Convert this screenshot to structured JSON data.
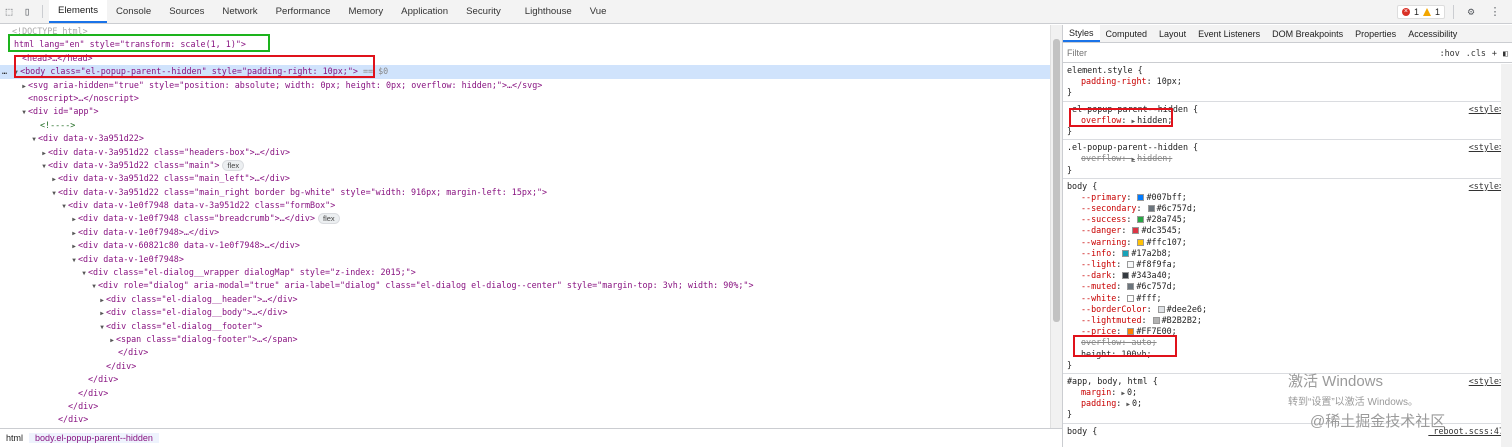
{
  "toolbar": {
    "tabs": [
      "Elements",
      "Console",
      "Sources",
      "Network",
      "Performance",
      "Memory",
      "Application",
      "Security",
      "Lighthouse",
      "Vue"
    ],
    "errors": "1",
    "warnings": "1"
  },
  "dom": {
    "lines": [
      "<!DOCTYPE html>",
      "html lang=\"en\" style=\"transform: scale(1, 1)\">",
      "<head>…</head>",
      "<body class=\"el-popup-parent--hidden\" style=\"padding-right: 10px;\">",
      "== $0",
      "<svg aria-hidden=\"true\" style=\"position: absolute; width: 0px; height: 0px; overflow: hidden;\">…</svg>",
      "<noscript>…</noscript>",
      "<div id=\"app\">",
      "<!---->",
      "<div data-v-3a951d22>",
      "<div data-v-3a951d22 class=\"headers-box\">…</div>",
      "<div data-v-3a951d22 class=\"main\">",
      "flex",
      "<div data-v-3a951d22 class=\"main_left\">…</div>",
      "<div data-v-3a951d22 class=\"main_right border bg-white\" style=\"width: 916px; margin-left: 15px;\">",
      "<div data-v-1e0f7948 data-v-3a951d22 class=\"formBox\">",
      "<div data-v-1e0f7948 class=\"breadcrumb\">…</div>",
      "flex",
      "<div data-v-1e0f7948>…</div>",
      "<div data-v-60821c80 data-v-1e0f7948>…</div>",
      "<div data-v-1e0f7948>",
      "<div class=\"el-dialog__wrapper dialogMap\" style=\"z-index: 2015;\">",
      "<div role=\"dialog\" aria-modal=\"true\" aria-label=\"dialog\" class=\"el-dialog el-dialog--center\" style=\"margin-top: 3vh; width: 90%;\">",
      "<div class=\"el-dialog__header\">…</div>",
      "<div class=\"el-dialog__body\">…</div>",
      "<div class=\"el-dialog__footer\">",
      "<span class=\"dialog-footer\">…</span>",
      "</div>",
      "</div>",
      "</div>",
      "</div>",
      "</div>",
      "</div>"
    ]
  },
  "breadcrumbs": [
    "html",
    "body.el-popup-parent--hidden"
  ],
  "styles": {
    "tabs": [
      "Styles",
      "Computed",
      "Layout",
      "Event Listeners",
      "DOM Breakpoints",
      "Properties",
      "Accessibility"
    ],
    "filter_placeholder": "Filter",
    "hov": ":hov",
    "cls": ".cls",
    "rules": {
      "element_style": {
        "selector": "element.style {",
        "prop": "padding-right",
        "val": "10px;"
      },
      "r1": {
        "selector": ".el-popup-parent--hidden {",
        "prop": "overflow",
        "val": "hidden;",
        "src": "<style>"
      },
      "r2": {
        "selector": ".el-popup-parent--hidden {",
        "prop": "overflow",
        "val": "hidden;",
        "src": "<style>"
      },
      "body": {
        "selector": "body {",
        "src": "<style>",
        "vars": [
          {
            "p": "--primary",
            "v": "#007bff;",
            "c": "#007bff"
          },
          {
            "p": "--secondary",
            "v": "#6c757d;",
            "c": "#6c757d"
          },
          {
            "p": "--success",
            "v": "#28a745;",
            "c": "#28a745"
          },
          {
            "p": "--danger",
            "v": "#dc3545;",
            "c": "#dc3545"
          },
          {
            "p": "--warning",
            "v": "#ffc107;",
            "c": "#ffc107"
          },
          {
            "p": "--info",
            "v": "#17a2b8;",
            "c": "#17a2b8"
          },
          {
            "p": "--light",
            "v": "#f8f9fa;",
            "c": "#f8f9fa"
          },
          {
            "p": "--dark",
            "v": "#343a40;",
            "c": "#343a40"
          },
          {
            "p": "--muted",
            "v": "#6c757d;",
            "c": "#6c757d"
          },
          {
            "p": "--white",
            "v": "#fff;",
            "c": "#ffffff"
          },
          {
            "p": "--borderColor",
            "v": "#dee2e6;",
            "c": "#dee2e6"
          },
          {
            "p": "--lightmuted",
            "v": "#B2B2B2;",
            "c": "#B2B2B2"
          },
          {
            "p": "--price",
            "v": "#FF7E00;",
            "c": "#FF7E00"
          }
        ],
        "overflow": "overflow: auto;",
        "height": "height: 100vh;"
      },
      "app": {
        "selector": "#app, body, html {",
        "src": "<style>",
        "margin": "0;",
        "padding": "0;"
      },
      "body2": {
        "selector": "body {",
        "src": "_reboot.scss:47"
      }
    }
  },
  "watermark": {
    "line1": "激活 Windows",
    "line2": "转到“设置”以激活 Windows。",
    "juejin": "@稀土掘金技术社区"
  }
}
